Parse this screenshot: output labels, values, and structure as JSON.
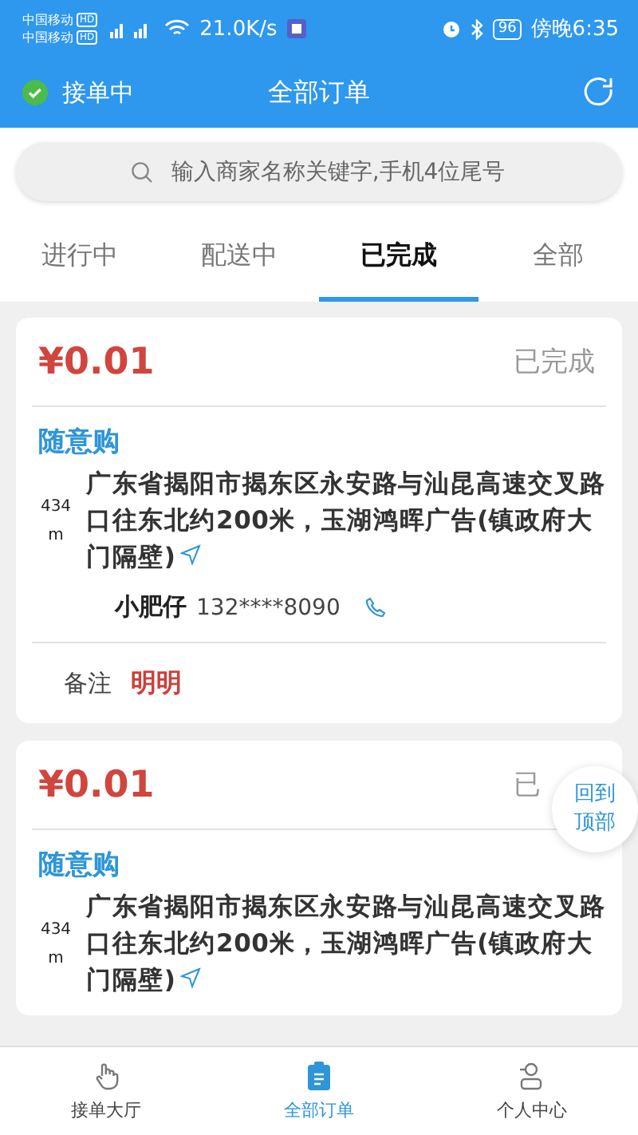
{
  "status_bar": {
    "carriers": [
      "中国移动",
      "中国移动"
    ],
    "hd_badges": [
      "HD",
      "HD"
    ],
    "speed": "21.0K/s",
    "battery": "96",
    "time": "傍晚6:35"
  },
  "header": {
    "status": "接单中",
    "title": "全部订单"
  },
  "search": {
    "placeholder": "输入商家名称关键字,手机4位尾号"
  },
  "tabs": [
    {
      "label": "进行中",
      "selected": false
    },
    {
      "label": "配送中",
      "selected": false
    },
    {
      "label": "已完成",
      "selected": true
    },
    {
      "label": "全部",
      "selected": false
    }
  ],
  "orders": [
    {
      "price": "¥0.01",
      "status": "已完成",
      "shop": "随意购",
      "distance": "434",
      "unit": "m",
      "address": "广东省揭阳市揭东区永安路与汕昆高速交叉路口往东北约200米，玉湖鸿晖广告(镇政府大门隔壁)",
      "customer": "小肥仔",
      "phone": "132****8090",
      "note_label": "备注",
      "note": "明明"
    },
    {
      "price": "¥0.01",
      "status": "已",
      "shop": "随意购",
      "distance": "434",
      "unit": "m",
      "address": "广东省揭阳市揭东区永安路与汕昆高速交叉路口往东北约200米，玉湖鸿晖广告(镇政府大门隔壁)"
    }
  ],
  "back_to_top": "回到顶部",
  "bottom_nav": [
    {
      "label": "接单大厅",
      "kind": "hand",
      "selected": false
    },
    {
      "label": "全部订单",
      "kind": "clipboard",
      "selected": true
    },
    {
      "label": "个人中心",
      "kind": "person",
      "selected": false
    }
  ]
}
